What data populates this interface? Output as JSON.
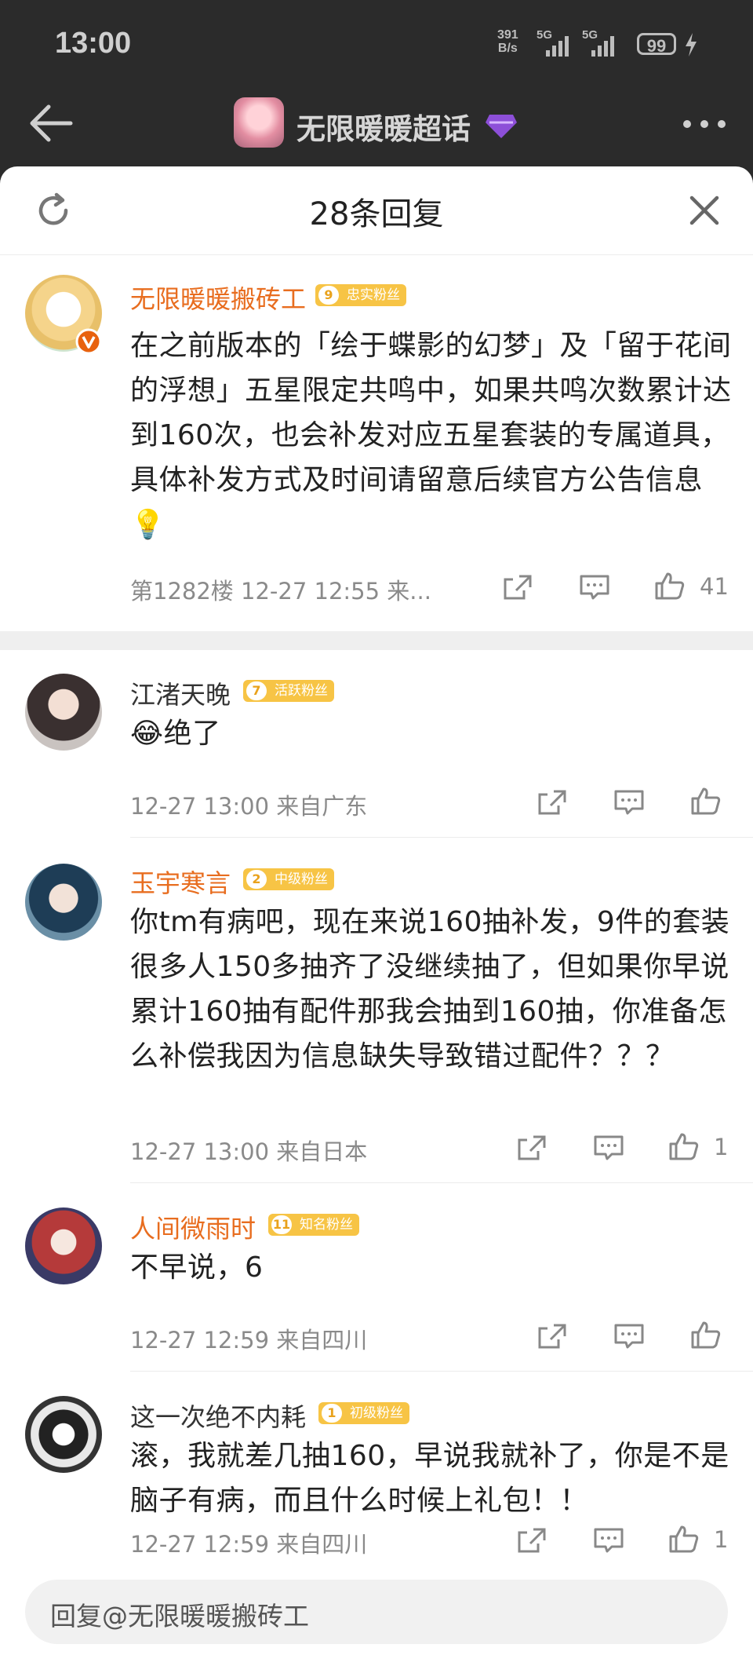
{
  "status_bar": {
    "time": "13:00",
    "net_speed_value": "391",
    "net_speed_unit": "B/s",
    "signal_1": "5G",
    "signal_2": "5G",
    "battery": "99"
  },
  "nav": {
    "title": "无限暖暖超话"
  },
  "sheet": {
    "title": "28条回复"
  },
  "main_comment": {
    "user": "无限暖暖搬砖工",
    "badge_level": "9",
    "badge_text": "忠实粉丝",
    "text": "在之前版本的「绘于蝶影的幻梦」及「留于花间的浮想」五星限定共鸣中，如果共鸣次数累计达到160次，也会补发对应五星套装的专属道具，具体补发方式及时间请留意后续官方公告信息💡",
    "meta": "第1282楼  12-27 12:55  来...",
    "likes": "41"
  },
  "replies": [
    {
      "user": "江渚天晚",
      "name_color": "gray",
      "badge_level": "7",
      "badge_text": "活跃粉丝",
      "text": "😂绝了",
      "meta": "12-27 13:00  来自广东",
      "likes": ""
    },
    {
      "user": "玉宇寒言",
      "name_color": "orange",
      "badge_level": "2",
      "badge_text": "中级粉丝",
      "text": "你tm有病吧，现在来说160抽补发，9件的套装很多人150多抽齐了没继续抽了，但如果你早说累计160抽有配件那我会抽到160抽，你准备怎么补偿我因为信息缺失导致错过配件？？？",
      "meta": "12-27 13:00  来自日本",
      "likes": "1"
    },
    {
      "user": "人间微雨时",
      "name_color": "orange",
      "badge_level": "11",
      "badge_text": "知名粉丝",
      "text": "不早说，6",
      "meta": "12-27 12:59  来自四川",
      "likes": ""
    },
    {
      "user": "这一次绝不内耗",
      "name_color": "gray",
      "badge_level": "1",
      "badge_text": "初级粉丝",
      "text": "滚，我就差几抽160，早说我就补了，你是不是脑子有病，而且什么时候上礼包！！",
      "meta": "12-27 12:59  来自四川",
      "likes": "1"
    }
  ],
  "reply_box": {
    "placeholder": "回复@无限暖暖搬砖工"
  },
  "colors": {
    "accent_orange": "#e86d1f",
    "badge_yellow": "#f7c445",
    "header_dark": "#2b2b2b"
  }
}
